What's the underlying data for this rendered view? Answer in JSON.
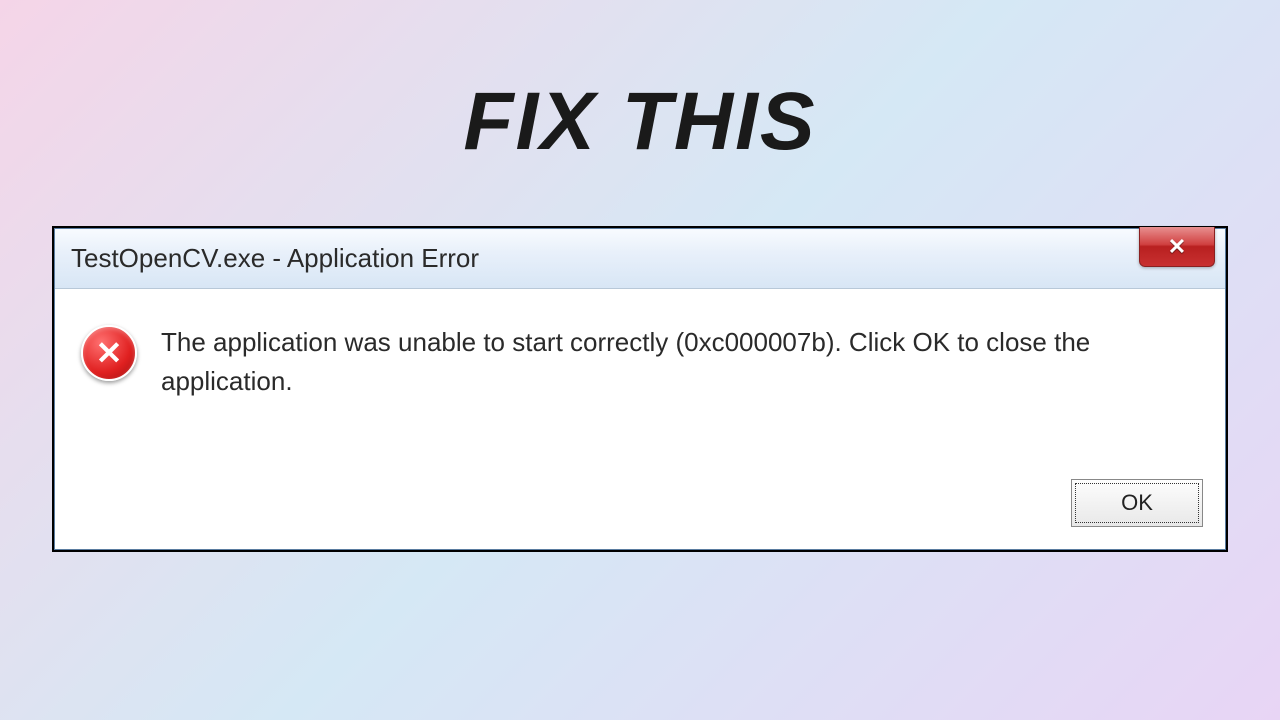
{
  "headline": "FIX  THIS",
  "dialog": {
    "title": "TestOpenCV.exe - Application Error",
    "message": "The application was unable to start correctly (0xc000007b). Click OK to close the application.",
    "ok_label": "OK",
    "close_symbol": "✕"
  }
}
